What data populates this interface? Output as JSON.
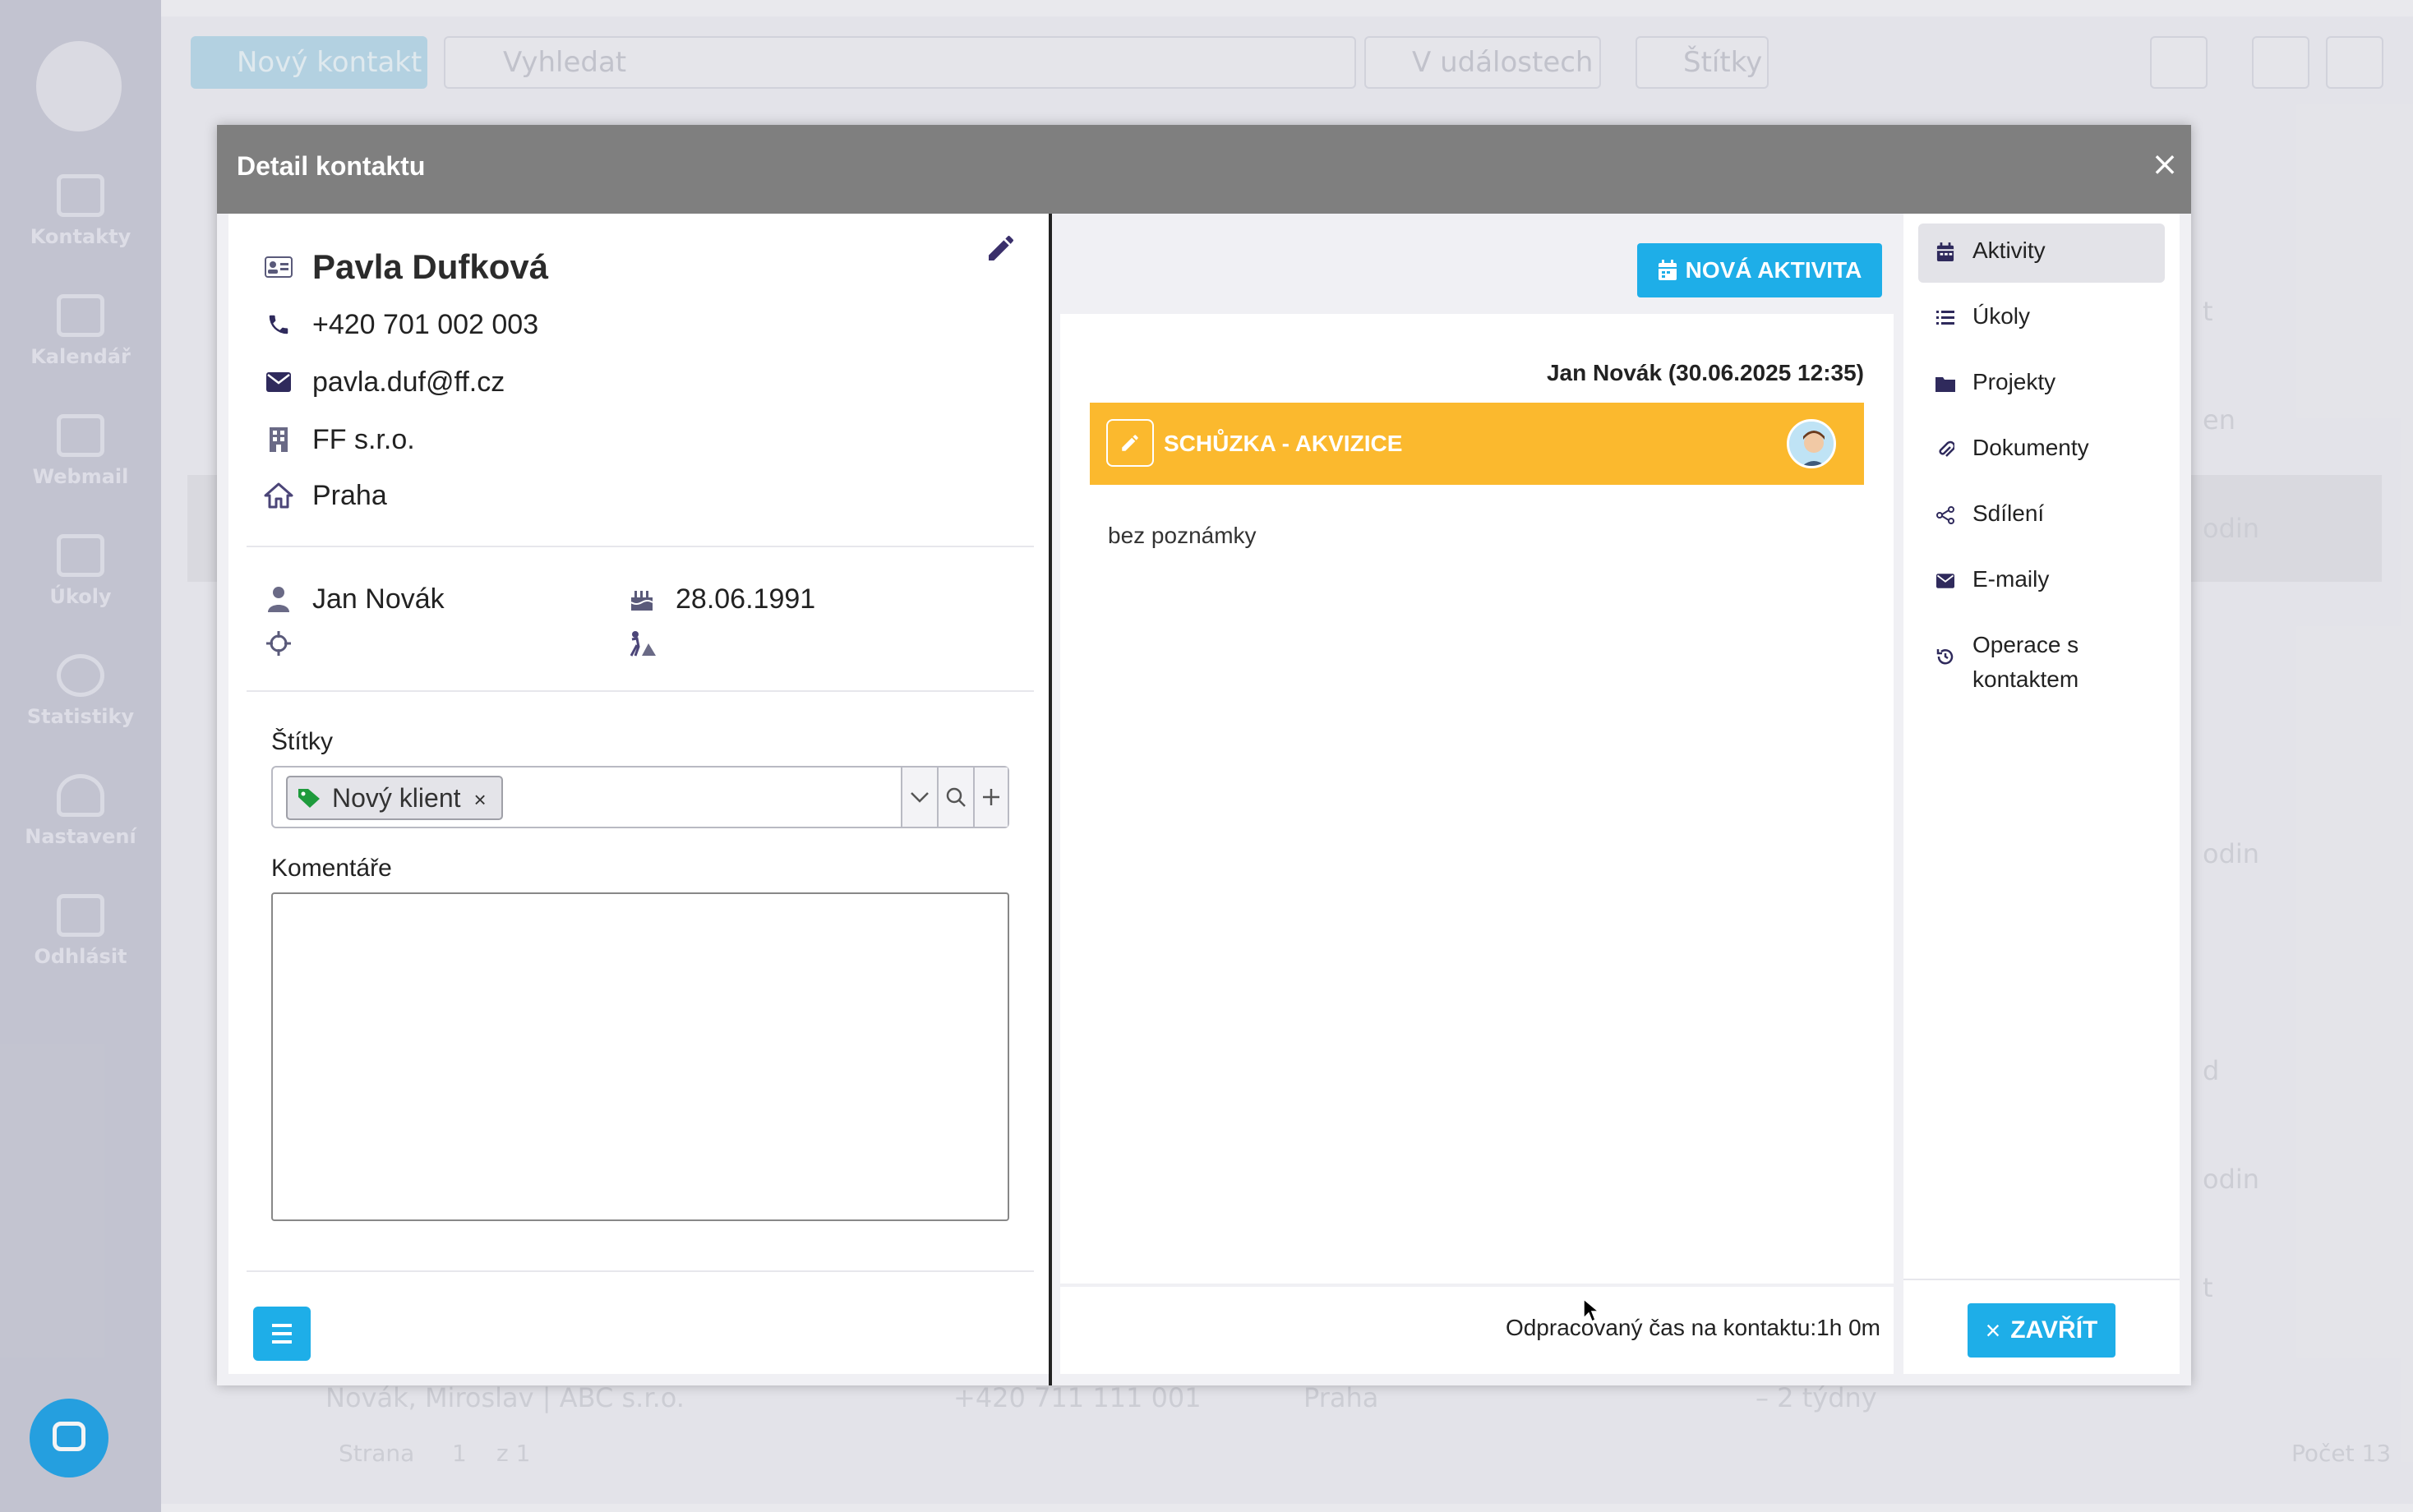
{
  "background": {
    "sidebar": [
      {
        "label": "Kontakty",
        "icon": "contacts-icon"
      },
      {
        "label": "Kalendář",
        "icon": "calendar-icon"
      },
      {
        "label": "Webmail",
        "icon": "mail-icon"
      },
      {
        "label": "Úkoly",
        "icon": "tasks-icon"
      },
      {
        "label": "Statistiky",
        "icon": "pie-chart-icon"
      },
      {
        "label": "Nastavení",
        "icon": "user-settings-icon"
      },
      {
        "label": "Odhlásit",
        "icon": "logout-icon"
      }
    ],
    "toolbar": {
      "new_contact": "Nový kontakt",
      "search_placeholder": "Vyhledat",
      "in_events": "V událostech",
      "tags": "Štítky"
    },
    "rows": [
      {
        "fragment": "t"
      },
      {
        "fragment": "en"
      },
      {
        "fragment": "odin"
      },
      {
        "fragment": "odin"
      },
      {
        "fragment": "d"
      },
      {
        "fragment": "odin"
      },
      {
        "fragment": "t"
      }
    ],
    "last_row": {
      "name": "Novák, Miroslav | ABC s.r.o.",
      "phone": "+420 711 111 001",
      "city": "Praha",
      "when": "– 2 týdny"
    },
    "pagination": {
      "strana": "Strana",
      "page": "1",
      "of": "z 1",
      "count": "Počet 13"
    }
  },
  "modal": {
    "title": "Detail kontaktu",
    "contact": {
      "name": "Pavla Dufková",
      "phone": "+420 701 002 003",
      "email": "pavla.duf@ff.cz",
      "company": "FF s.r.o.",
      "city": "Praha",
      "owner": "Jan Novák",
      "birthday": "28.06.1991"
    },
    "tags_label": "Štítky",
    "tags": [
      {
        "label": "Nový klient",
        "color": "#1e9b3c"
      }
    ],
    "comments_label": "Komentáře",
    "comments_value": "",
    "new_activity_button": "NOVÁ AKTIVITA",
    "activity": {
      "author": "Jan Novák (30.06.2025 12:35)",
      "title": "SCHŮZKA - AKVIZICE",
      "note": "bez poznámky",
      "bar_color": "#fbb92e"
    },
    "worked_time": "Odpracovaný čas na kontaktu:1h 0m",
    "tabs": [
      {
        "label": "Aktivity",
        "icon": "calendar-icon",
        "active": true
      },
      {
        "label": "Úkoly",
        "icon": "list-icon",
        "active": false
      },
      {
        "label": "Projekty",
        "icon": "folder-icon",
        "active": false
      },
      {
        "label": "Dokumenty",
        "icon": "paperclip-icon",
        "active": false
      },
      {
        "label": "Sdílení",
        "icon": "share-icon",
        "active": false
      },
      {
        "label": "E-maily",
        "icon": "envelope-icon",
        "active": false
      },
      {
        "label": "Operace s kontaktem",
        "icon": "history-icon",
        "active": false
      }
    ],
    "close_button": "ZAVŘÍT",
    "accent_color": "#1eaee8"
  }
}
